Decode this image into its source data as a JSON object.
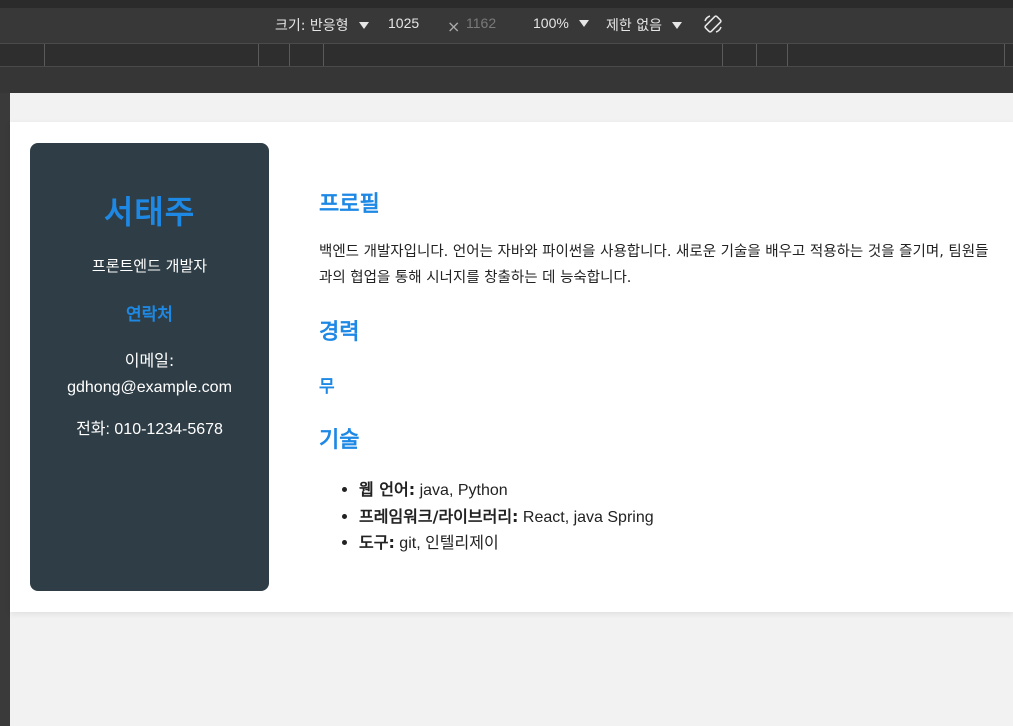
{
  "devtools": {
    "size_label": "크기: 반응형",
    "width_value": "1025",
    "times": "×",
    "height_value": "1162",
    "zoom": "100%",
    "throttle": "제한 없음",
    "rotate_icon": "rotate-icon"
  },
  "resume": {
    "name": "서태주",
    "role": "프론트엔드 개발자",
    "contact_heading": "연락처",
    "email_label": "이메일:",
    "email": "gdhong@example.com",
    "phone": "전화: 010-1234-5678",
    "profile_heading": "프로필",
    "profile_text": "백엔드 개발자입니다. 언어는 자바와 파이썬을 사용합니다. 새로운 기술을 배우고 적용하는 것을 즐기며, 팀원들과의 협업을 통해 시너지를 창출하는 데 능숙합니다.",
    "career_heading": "경력",
    "career_item": "무",
    "skills_heading": "기술",
    "skills": [
      {
        "label": "웹 언어:",
        "value": " java, Python"
      },
      {
        "label": "프레임워크/라이브러리:",
        "value": " React, java Spring"
      },
      {
        "label": "도구:",
        "value": " git, 인텔리제이"
      }
    ]
  },
  "colors": {
    "accent": "#1e88e5",
    "sidebar_bg": "#2f3e46",
    "devtools_bg": "#383838"
  }
}
